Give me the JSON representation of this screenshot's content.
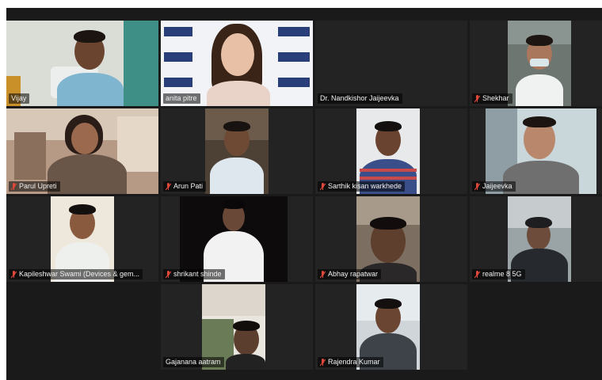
{
  "meeting": {
    "tiles": [
      {
        "name": "Vijay",
        "muted": false,
        "active": true
      },
      {
        "name": "anita pitre",
        "muted": false,
        "active": false
      },
      {
        "name": "Dr. Nandkishor Jaijeevka",
        "muted": false,
        "active": false
      },
      {
        "name": "Shekhar",
        "muted": true,
        "active": false
      },
      {
        "name": "Parul Upreti",
        "muted": true,
        "active": false
      },
      {
        "name": "Arun Pati",
        "muted": true,
        "active": false
      },
      {
        "name": "Sarthik kisan warkhede",
        "muted": true,
        "active": false
      },
      {
        "name": "Jaijeevka",
        "muted": true,
        "active": false
      },
      {
        "name": "Kapileshwar Swami (Devices & gem...",
        "muted": true,
        "active": false
      },
      {
        "name": "shrikant shinde",
        "muted": true,
        "active": false
      },
      {
        "name": "Abhay rapatwar",
        "muted": true,
        "active": false
      },
      {
        "name": "realme 8 5G",
        "muted": true,
        "active": false
      },
      {
        "name": "Gajanana aatram",
        "muted": false,
        "active": false
      },
      {
        "name": "Rajendra Kumar",
        "muted": true,
        "active": false
      }
    ],
    "backdrop_text": "Jaijeevka",
    "colors": {
      "muted_icon": "#e0483a",
      "active_border": "#c7d93a",
      "tile_bg": "#232323"
    }
  }
}
